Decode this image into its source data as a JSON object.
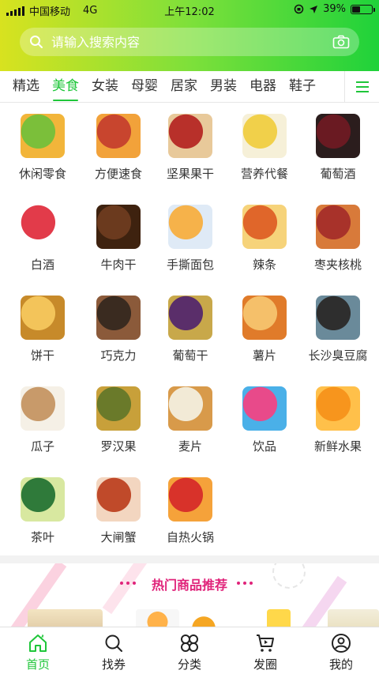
{
  "status_bar": {
    "carrier": "中国移动",
    "network": "4G",
    "time": "上午12:02",
    "battery": "39%"
  },
  "search": {
    "placeholder": "请输入搜索内容"
  },
  "tabs": [
    {
      "label": "精选",
      "active": false
    },
    {
      "label": "美食",
      "active": true
    },
    {
      "label": "女装",
      "active": false
    },
    {
      "label": "母婴",
      "active": false
    },
    {
      "label": "居家",
      "active": false
    },
    {
      "label": "男装",
      "active": false
    },
    {
      "label": "电器",
      "active": false
    },
    {
      "label": "鞋子",
      "active": false
    }
  ],
  "categories": [
    {
      "label": "休闲零食",
      "icon": "snacks-image"
    },
    {
      "label": "方便速食",
      "icon": "instant-food-image"
    },
    {
      "label": "坚果果干",
      "icon": "nuts-image"
    },
    {
      "label": "营养代餐",
      "icon": "meal-replacement-image"
    },
    {
      "label": "葡萄酒",
      "icon": "wine-image"
    },
    {
      "label": "白酒",
      "icon": "baijiu-image"
    },
    {
      "label": "牛肉干",
      "icon": "beef-jerky-image"
    },
    {
      "label": "手撕面包",
      "icon": "bread-image"
    },
    {
      "label": "辣条",
      "icon": "spicy-strip-image"
    },
    {
      "label": "枣夹核桃",
      "icon": "date-walnut-image"
    },
    {
      "label": "饼干",
      "icon": "biscuit-image"
    },
    {
      "label": "巧克力",
      "icon": "chocolate-image"
    },
    {
      "label": "葡萄干",
      "icon": "raisin-image"
    },
    {
      "label": "薯片",
      "icon": "chips-image"
    },
    {
      "label": "长沙臭豆腐",
      "icon": "stinky-tofu-image"
    },
    {
      "label": "瓜子",
      "icon": "seeds-image"
    },
    {
      "label": "罗汉果",
      "icon": "monk-fruit-image"
    },
    {
      "label": "麦片",
      "icon": "oatmeal-image"
    },
    {
      "label": "饮品",
      "icon": "drinks-image"
    },
    {
      "label": "新鲜水果",
      "icon": "fresh-fruit-image"
    },
    {
      "label": "茶叶",
      "icon": "tea-image"
    },
    {
      "label": "大闸蟹",
      "icon": "crab-image"
    },
    {
      "label": "自热火锅",
      "icon": "hotpot-image"
    }
  ],
  "hot_section": {
    "title": "热门商品推荐"
  },
  "bottom_nav": [
    {
      "label": "首页",
      "icon": "home-icon",
      "active": true
    },
    {
      "label": "找券",
      "icon": "search-icon",
      "active": false
    },
    {
      "label": "分类",
      "icon": "category-icon",
      "active": false
    },
    {
      "label": "发圈",
      "icon": "share-icon",
      "active": false
    },
    {
      "label": "我的",
      "icon": "profile-icon",
      "active": false
    }
  ],
  "colors": {
    "accent": "#1fc63a",
    "hot_title": "#e0237a"
  }
}
